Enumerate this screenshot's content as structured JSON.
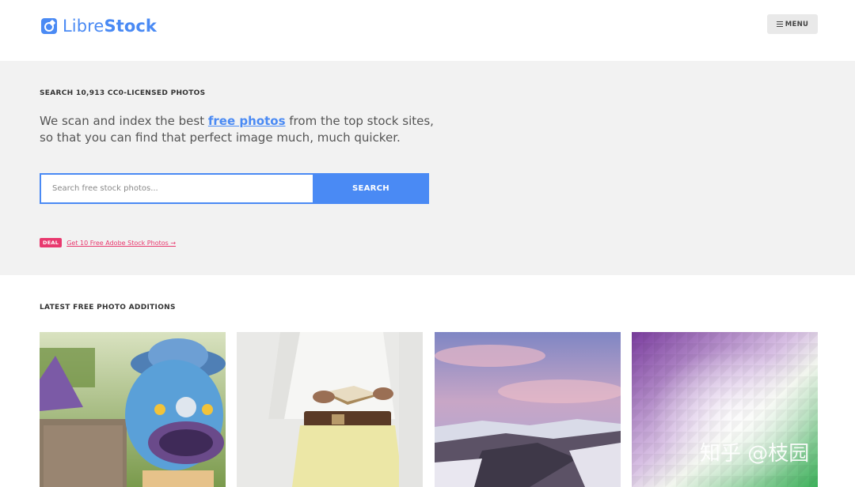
{
  "header": {
    "logo_light": "Libre",
    "logo_bold": "Stock",
    "menu_label": "MENU"
  },
  "hero": {
    "kicker": "SEARCH 10,913 CC0-LICENSED PHOTOS",
    "desc_before": "We scan and index the best ",
    "desc_link": "free photos",
    "desc_after": " from the top stock sites, so that you can find that perfect image much, much quicker.",
    "search_placeholder": "Search free stock photos...",
    "search_button": "SEARCH",
    "deal_badge": "DEAL",
    "deal_link": "Get 10 Free Adobe Stock Photos →"
  },
  "latest": {
    "title": "LATEST FREE PHOTO ADDITIONS"
  },
  "colors": {
    "brand": "#4a8af4",
    "deal": "#e8386e",
    "hero_bg": "#f2f2f2"
  },
  "watermark": "知乎 @枝园"
}
